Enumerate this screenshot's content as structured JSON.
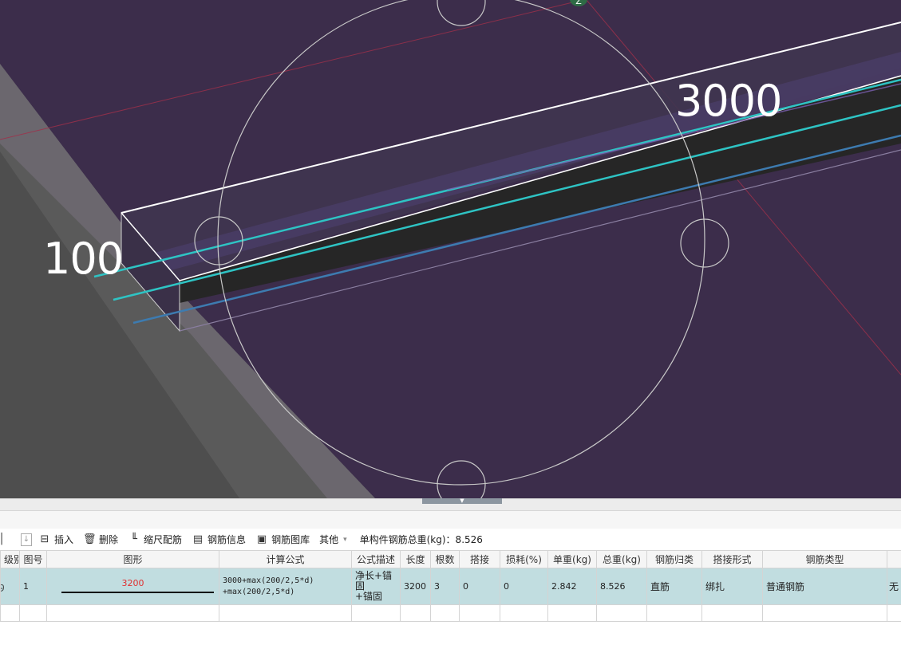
{
  "viewport": {
    "dimension_left": "100",
    "dimension_right": "3000",
    "axis_marker": "Z"
  },
  "toolbar": {
    "insert_label": "插入",
    "delete_label": "删除",
    "scale_rebar_label": "缩尺配筋",
    "rebar_info_label": "钢筋信息",
    "rebar_library_label": "钢筋图库",
    "other_label": "其他",
    "total_weight_label": "单构件钢筋总重(kg)：8.526"
  },
  "grid": {
    "headers": [
      "级别",
      "图号",
      "图形",
      "计算公式",
      "公式描述",
      "长度",
      "根数",
      "搭接",
      "损耗(%)",
      "单重(kg)",
      "总重(kg)",
      "钢筋归类",
      "搭接形式",
      "钢筋类型",
      ""
    ],
    "row": {
      "grade": "",
      "figure_no": "1",
      "shape_value": "3200",
      "formula_line1": "3000+max(200/2,5*d)",
      "formula_line2": "+max(200/2,5*d)",
      "desc_line1": "净长+锚固",
      "desc_line2": "+锚固",
      "length": "3200",
      "count": "3",
      "lap": "0",
      "loss": "0",
      "unit_weight": "2.842",
      "total_weight": "8.526",
      "category": "直筋",
      "lap_type": "绑扎",
      "rebar_type": "普通钢筋",
      "extra": "无"
    }
  },
  "colors": {
    "viewport_bg": "#3c2d4b",
    "row_highlight": "#c1dde0",
    "shape_number": "#e03030",
    "rebar_cyan": "#2ec4c4",
    "rebar_blue": "#3d7bb0"
  }
}
